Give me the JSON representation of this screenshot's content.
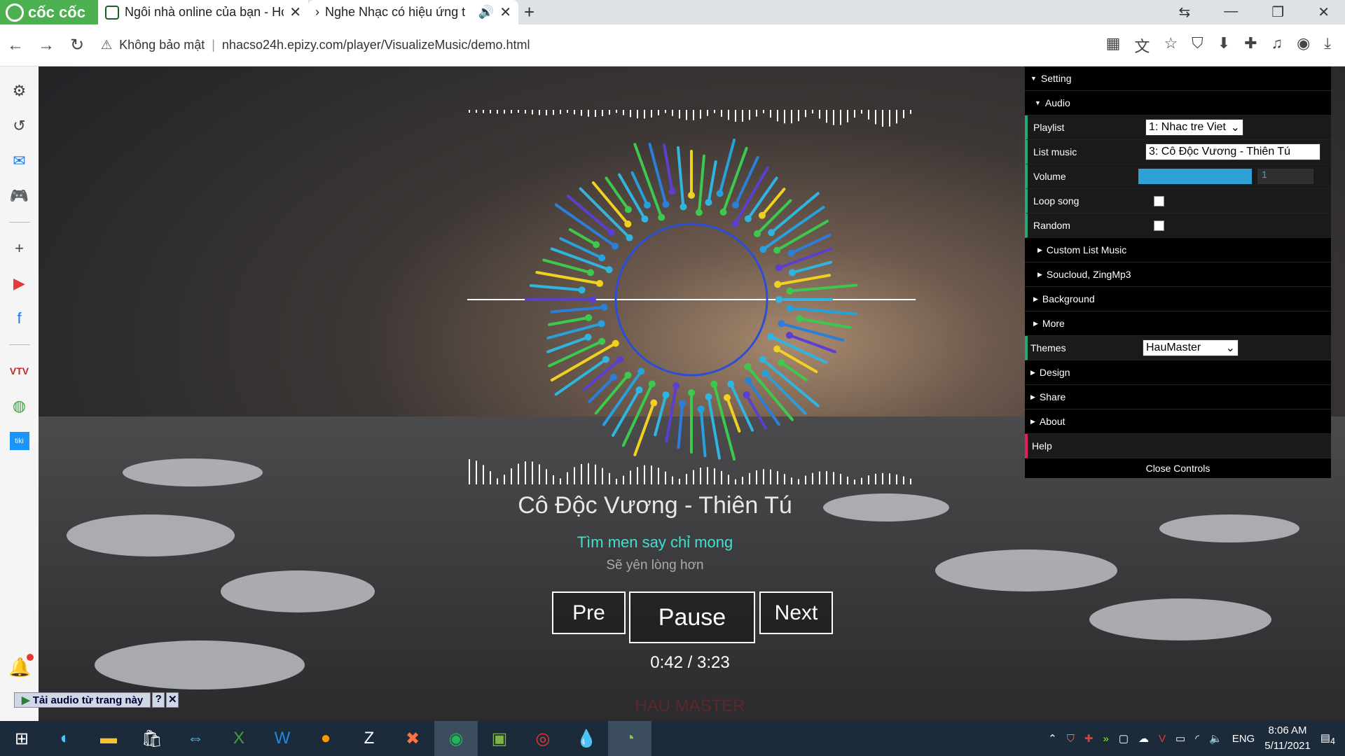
{
  "browser": {
    "brand": "cốc cốc",
    "tabs": [
      {
        "title": "Ngôi nhà online của bạn - Ho",
        "active": false
      },
      {
        "title": "Nghe Nhạc có hiệu ứng t",
        "active": true
      }
    ],
    "address": {
      "security": "Không bảo mật",
      "url": "nhacso24h.epizy.com/player/VisualizeMusic/demo.html"
    }
  },
  "player": {
    "song_title": "Cô Độc Vương - Thiên Tú",
    "lyric_current": "Tìm men say chỉ mong",
    "lyric_next": "Sẽ yên lòng hơn",
    "pre_label": "Pre",
    "pause_label": "Pause",
    "next_label": "Next",
    "time": "0:42 / 3:23",
    "watermark": "HAU MASTER"
  },
  "panel": {
    "setting": "Setting",
    "audio": "Audio",
    "playlist_label": "Playlist",
    "playlist_value": "1: Nhac tre Viet",
    "listmusic_label": "List music",
    "listmusic_value": "3: Cô Độc Vương - Thiên Tú",
    "volume_label": "Volume",
    "volume_value": "1",
    "loop_label": "Loop song",
    "random_label": "Random",
    "custom_list": "Custom List Music",
    "soucloud": "Soucloud, ZingMp3",
    "background": "Background",
    "more": "More",
    "themes_label": "Themes",
    "themes_value": "HauMaster",
    "design": "Design",
    "share": "Share",
    "about": "About",
    "help": "Help",
    "close": "Close Controls"
  },
  "download_bar": {
    "label": "Tải audio từ trang này"
  },
  "taskbar": {
    "language": "ENG",
    "time": "8:06 AM",
    "date": "5/11/2021",
    "notif_count": "4"
  }
}
